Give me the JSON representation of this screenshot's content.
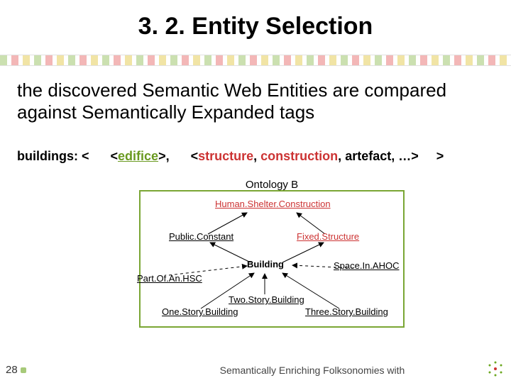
{
  "title": "3. 2. Entity Selection",
  "subtitle": "the discovered Semantic Web Entities are compared against Semantically Expanded tags",
  "tagline": {
    "prefix": "buildings: <",
    "edifice": "edifice",
    "after_edifice": ">,",
    "open2": "<",
    "structure": "structure",
    "comma1": ", ",
    "construction": "construction",
    "comma2": ", ",
    "artefact": "artefact",
    "tail": ", …>",
    "close": ">"
  },
  "ontology": {
    "title": "Ontology B",
    "nodes": {
      "root": "Human.Shelter.Construction",
      "publicConstant": "Public.Constant",
      "fixedStructure": "Fixed.Structure",
      "building": "Building",
      "partOfAnHSC": "Part.Of.An.HSC",
      "spaceInAHOC": "Space.In.AHOC",
      "twoStory": "Two.Story.Building",
      "oneStory": "One.Story.Building",
      "threeStory": "Three.Story.Building"
    }
  },
  "pageNumber": "28",
  "footer": "Semantically Enriching Folksonomies with"
}
